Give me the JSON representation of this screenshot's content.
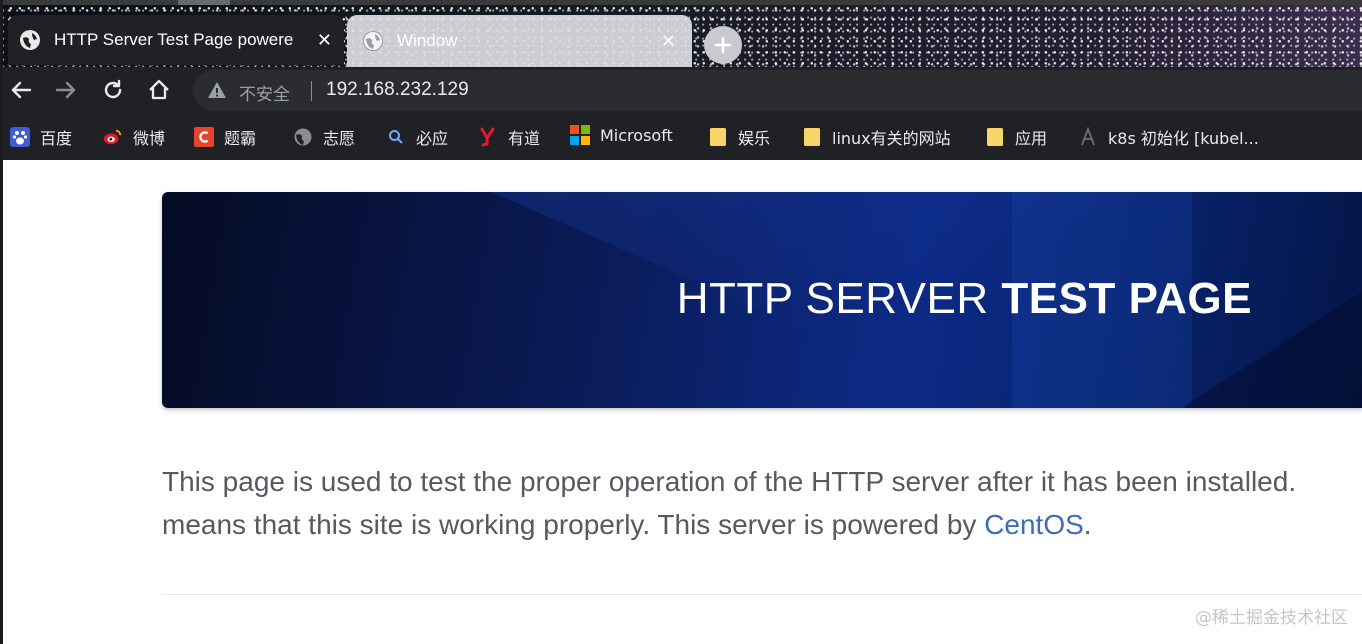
{
  "tabs": [
    {
      "title": "HTTP Server Test Page powere",
      "active": true
    },
    {
      "title": "Window",
      "active": false
    }
  ],
  "toolbar": {
    "security_label": "不安全",
    "url": "192.168.232.129"
  },
  "bookmarks": [
    {
      "label": "百度",
      "icon": "baidu-icon"
    },
    {
      "label": "微博",
      "icon": "weibo-icon"
    },
    {
      "label": "题霸",
      "icon": "c-icon"
    },
    {
      "label": "志愿",
      "icon": "globe-icon"
    },
    {
      "label": "必应",
      "icon": "search-icon"
    },
    {
      "label": "有道",
      "icon": "youdao-icon"
    },
    {
      "label": "Microsoft",
      "icon": "microsoft-icon"
    },
    {
      "label": "娱乐",
      "icon": "folder-icon"
    },
    {
      "label": "linux有关的网站",
      "icon": "folder-icon"
    },
    {
      "label": "应用",
      "icon": "folder-icon"
    },
    {
      "label": "k8s 初始化 [kubel...",
      "icon": "k8s-icon"
    }
  ],
  "page": {
    "title_normal": "HTTP SERVER ",
    "title_bold": "TEST PAGE",
    "intro_line1": "This page is used to test the proper operation of the HTTP server after it has been installed.",
    "intro_line2_prefix": "means that this site is working properly. This server is powered by ",
    "intro_link": "CentOS",
    "intro_line2_suffix": "."
  },
  "watermark": "@稀土掘金技术社区",
  "colors": {
    "banner_dark": "#050b24",
    "banner_blue": "#0c2a86",
    "link": "#3c6eb4",
    "body_text": "#555a61",
    "chrome_bg": "#202124"
  }
}
